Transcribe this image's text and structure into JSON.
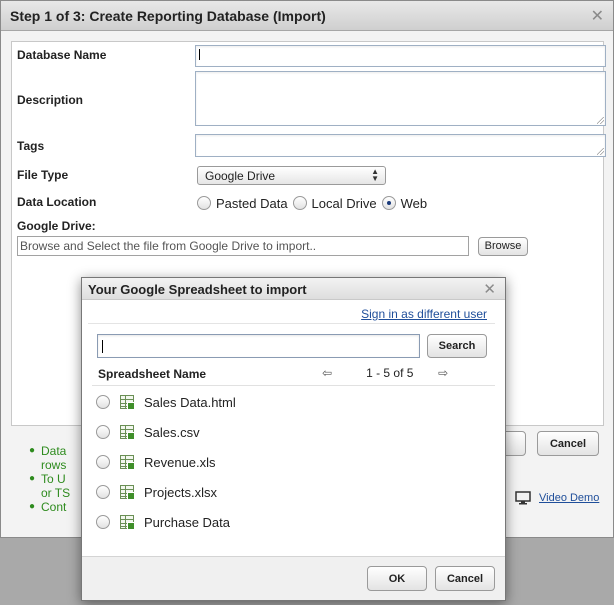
{
  "main_dialog": {
    "title": "Step 1 of 3: Create Reporting Database (Import)",
    "close_glyph": "✕",
    "close_icon": "close-icon",
    "fields": {
      "database_name_label": "Database Name",
      "description_label": "Description",
      "tags_label": "Tags",
      "file_type_label": "File Type",
      "file_type_value": "Google Drive",
      "data_location_label": "Data Location",
      "data_location_options": [
        "Pasted Data",
        "Local Drive",
        "Web"
      ],
      "data_location_selected": "Web",
      "google_drive_label": "Google Drive:",
      "google_drive_placeholder": "Browse and Select the file from Google Drive to import..",
      "browse_label": "Browse"
    },
    "footer": {
      "cancel_label": "Cancel",
      "video_demo_label": "Video Demo",
      "video_icon": "monitor-icon",
      "bullets": [
        "Data",
        "rows",
        "To U",
        "or TS",
        "Cont"
      ]
    }
  },
  "modal": {
    "title": "Your Google Spreadsheet to import",
    "close_glyph": "✕",
    "sign_in_label": "Sign in as different user",
    "search_button_label": "Search",
    "list_header": "Spreadsheet Name",
    "pager": {
      "range": "1 - 5 of 5",
      "prev_glyph": "⇦",
      "next_glyph": "⇨"
    },
    "files": [
      "Sales Data.html",
      "Sales.csv",
      "Revenue.xls",
      "Projects.xlsx",
      "Purchase Data"
    ],
    "ok_label": "OK",
    "cancel_label": "Cancel"
  },
  "colors": {
    "link": "#1f4e9a",
    "bullet_text": "#2e8b1e",
    "overlay_background": "#a9a9a9"
  }
}
